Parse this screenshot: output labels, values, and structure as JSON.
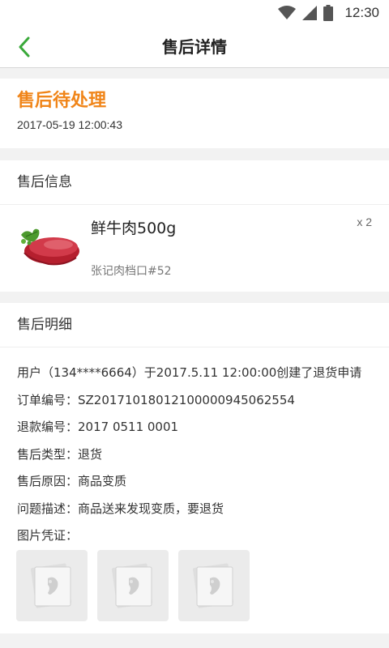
{
  "status_bar": {
    "time": "12:30",
    "icons": [
      "wifi-icon",
      "signal-icon",
      "battery-icon"
    ]
  },
  "navbar": {
    "title": "售后详情",
    "back_icon": "chevron-left-icon",
    "accent_color": "#3aa93a"
  },
  "status_section": {
    "status": "售后待处理",
    "status_color": "#f08519",
    "time": "2017-05-19 12:00:43"
  },
  "info_section": {
    "header": "售后信息",
    "product": {
      "name": "鲜牛肉500g",
      "quantity": "x 2",
      "shop": "张记肉档口#52"
    }
  },
  "detail_section": {
    "header": "售后明细",
    "lines": [
      "用户（134****6664）于2017.5.11 12:00:00创建了退货申请",
      "订单编号：SZ20171018012100000945062554",
      "退款编号：2017 0511 0001",
      "售后类型：退货",
      "售后原因：商品变质",
      "问题描述：商品送来发现变质，要退货",
      "图片凭证："
    ],
    "photo_count": 3
  }
}
